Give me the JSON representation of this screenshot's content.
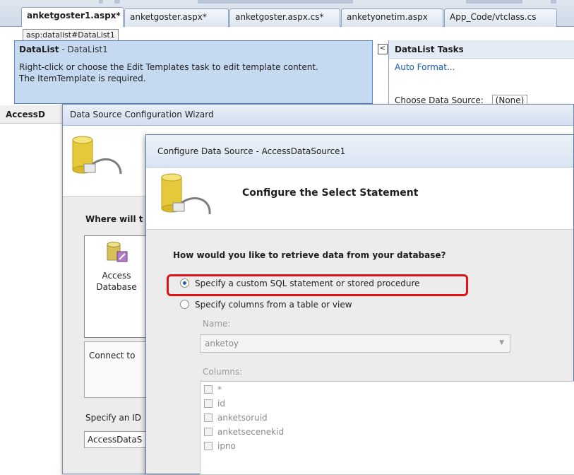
{
  "tabs": [
    {
      "label": "anketgoster1.aspx*",
      "active": true
    },
    {
      "label": "anketgoster.aspx*",
      "active": false
    },
    {
      "label": "anketgoster.aspx.cs*",
      "active": false
    },
    {
      "label": "anketyonetim.aspx",
      "active": false
    },
    {
      "label": "App_Code/vtclass.cs",
      "active": false
    }
  ],
  "designer": {
    "tag_label": "asp:datalist#DataList1",
    "datalist": {
      "title": "DataList",
      "subtitle": " - DataList1",
      "message_line1": "Right-click or choose the Edit Templates task to edit template content.",
      "message_line2": "The ItemTemplate is required."
    },
    "tasks": {
      "collapse_glyph": "<",
      "title": "DataList Tasks",
      "auto_format": "Auto Format...",
      "choose_label": "Choose Data Source:",
      "choose_value": "(None)"
    },
    "row_label": "AccessD"
  },
  "wizard1": {
    "title": "Data Source Configuration Wizard",
    "where_label": "Where will t",
    "item_label_line1": "Access",
    "item_label_line2": "Database",
    "description": "Connect to",
    "id_label": "Specify an ID",
    "id_value": "AccessDataS"
  },
  "wizard2": {
    "title": "Configure Data Source - AccessDataSource1",
    "heading": "Configure the Select Statement",
    "question": "How would you like to retrieve data from your database?",
    "option_custom": "Specify a custom SQL statement or stored procedure",
    "option_columns": "Specify columns from a table or view",
    "selected_option": "custom",
    "name_label": "Name:",
    "name_value": "anketoy",
    "columns_label": "Columns:",
    "columns": [
      "*",
      "id",
      "anketsoruid",
      "anketsecenekid",
      "ipno"
    ]
  },
  "colors": {
    "highlight": "#e0131b",
    "datalist_panel": "#c5d9f1",
    "link": "#1a5db3"
  }
}
